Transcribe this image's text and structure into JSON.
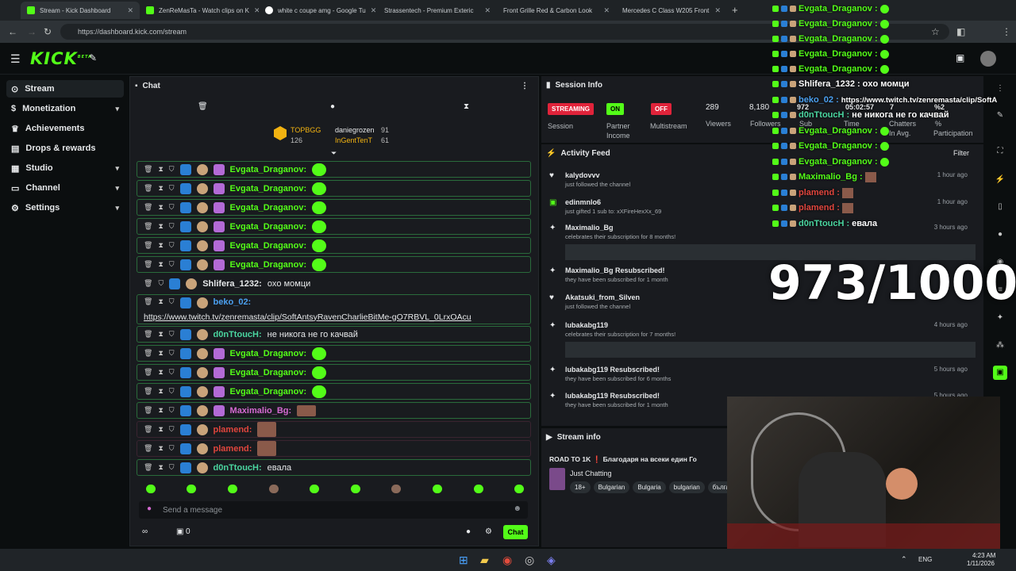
{
  "browser": {
    "tabs": [
      {
        "label": "Stream - Kick Dashboard",
        "active": true
      },
      {
        "label": "ZenReMasTa - Watch clips on K"
      },
      {
        "label": "white c coupe amg - Google Tu"
      },
      {
        "label": "Strassentech - Premium Exteric"
      },
      {
        "label": "Front Grille Red & Carbon Look"
      },
      {
        "label": "Mercedes C Class W205 Front"
      }
    ],
    "url": "https://dashboard.kick.com/stream"
  },
  "brand": {
    "logo": "KICK",
    "beta": "BETA"
  },
  "sidebar": {
    "items": [
      {
        "label": "Stream",
        "icon": "broadcast-icon"
      },
      {
        "label": "Monetization",
        "icon": "dollar-icon"
      },
      {
        "label": "Achievements",
        "icon": "trophy-icon"
      },
      {
        "label": "Drops & rewards",
        "icon": "gift-icon"
      },
      {
        "label": "Studio",
        "icon": "studio-icon"
      },
      {
        "label": "Channel",
        "icon": "channel-icon"
      },
      {
        "label": "Settings",
        "icon": "gear-icon"
      }
    ]
  },
  "chat": {
    "title": "Chat",
    "top_gifters": {
      "label": "TOPBGG",
      "count": "126"
    },
    "pinned_users": [
      {
        "name": "daniegrozen",
        "count": "91"
      },
      {
        "name": "InGentTenT",
        "count": "61"
      }
    ],
    "messages": [
      {
        "user": "Evgata_Draganov:",
        "text": "",
        "color": "green"
      },
      {
        "user": "Evgata_Draganov:",
        "text": "",
        "color": "green"
      },
      {
        "user": "Evgata_Draganov:",
        "text": "",
        "color": "green"
      },
      {
        "user": "Evgata_Draganov:",
        "text": "",
        "color": "green"
      },
      {
        "user": "Evgata_Draganov:",
        "text": "",
        "color": "green"
      },
      {
        "user": "Evgata_Draganov:",
        "text": "",
        "color": "green"
      },
      {
        "user": "Shlifera_1232:",
        "text": "oxo момци",
        "color": "plain"
      },
      {
        "user": "beko_02:",
        "text": "https://www.twitch.tv/zenremasta/clip/SoftAntsyRavenCharlieBitMe-gO7RBVL_0LrxOAcu",
        "color": "blue"
      },
      {
        "user": "d0nTtoucH:",
        "text": "не никога не го качвай",
        "color": "teal"
      },
      {
        "user": "Evgata_Draganov:",
        "text": "",
        "color": "green"
      },
      {
        "user": "Evgata_Draganov:",
        "text": "",
        "color": "green"
      },
      {
        "user": "Evgata_Draganov:",
        "text": "",
        "color": "green"
      },
      {
        "user": "Maximalio_Bg:",
        "text": "",
        "color": "pink"
      },
      {
        "user": "plamend:",
        "text": "",
        "color": "red"
      },
      {
        "user": "plamend:",
        "text": "",
        "color": "red"
      },
      {
        "user": "d0nTtoucH:",
        "text": "евала",
        "color": "teal"
      }
    ],
    "input_placeholder": "Send a message",
    "chat_button": "Chat",
    "viewer_count": "0"
  },
  "session": {
    "title": "Session Info",
    "streaming": "STREAMING",
    "streaming_label": "Session",
    "on": "ON",
    "on_label_1": "Partner",
    "on_label_2": "Income",
    "off": "OFF",
    "off_label": "Multistream",
    "viewers": "289",
    "viewers_label": "Viewers",
    "followers": "8,180",
    "followers_label": "Followers"
  },
  "feed": {
    "title": "Activity Feed",
    "filter": "Filter",
    "items": [
      {
        "name": "kalydovvv",
        "sub": "just followed the channel",
        "time": "1 hour ago"
      },
      {
        "name": "edinmnlo6",
        "sub": "just gifted 1 sub to: xXFireHexXx_69",
        "time": "1 hour ago"
      },
      {
        "name": "Maximalio_Bg",
        "sub": "celebrates their subscription for 8 months!",
        "time": "3 hours ago"
      },
      {
        "name": "Maximalio_Bg Resubscribed!",
        "sub": "they have been subscribed for 1 month",
        "time": ""
      },
      {
        "name": "Akatsuki_from_Silven",
        "sub": "just followed the channel",
        "time": ""
      },
      {
        "name": "lubakabg119",
        "sub": "celebrates their subscription for 7 months!",
        "time": "4 hours ago"
      },
      {
        "name": "lubakabg119 Resubscribed!",
        "sub": "they have been subscribed for 6 months",
        "time": "5 hours ago"
      },
      {
        "name": "lubakabg119 Resubscribed!",
        "sub": "they have been subscribed for 1 month",
        "time": "5 hours ago"
      }
    ]
  },
  "stream_info": {
    "title": "Stream info",
    "stream_title": "ROAD TO 1K ❗ Благодаря на всеки един Го",
    "category": "Just Chatting",
    "tags": [
      "18+",
      "Bulgarian",
      "Bulgaria",
      "bulgarian",
      "българ"
    ]
  },
  "overlay": {
    "lines": [
      {
        "user": "Evgata_Draganov :",
        "text": "",
        "color": "green"
      },
      {
        "user": "Evgata_Draganov :",
        "text": "",
        "color": "green"
      },
      {
        "user": "Evgata_Draganov :",
        "text": "",
        "color": "green"
      },
      {
        "user": "Evgata_Draganov :",
        "text": "",
        "color": "green"
      },
      {
        "user": "Evgata_Draganov :",
        "text": "",
        "color": "green"
      },
      {
        "user": "Shlifera_1232 :",
        "text": "oxo момци",
        "color": "white"
      },
      {
        "user": "beko_02 :",
        "text": "https://www.twitch.tv/zenremasta/clip/SoftA",
        "color": "blue"
      },
      {
        "user": "d0nTtoucH :",
        "text": "не никога не го качвай",
        "color": "teal"
      },
      {
        "user": "Evgata_Draganov :",
        "text": "",
        "color": "green"
      },
      {
        "user": "Evgata_Draganov :",
        "text": "",
        "color": "green"
      },
      {
        "user": "Evgata_Draganov :",
        "text": "",
        "color": "green"
      },
      {
        "user": "Maximalio_Bg :",
        "text": "",
        "color": "green"
      },
      {
        "user": "plamend :",
        "text": "",
        "color": "red"
      },
      {
        "user": "plamend :",
        "text": "",
        "color": "red"
      },
      {
        "user": "d0nTtoucH :",
        "text": "евала",
        "color": "teal"
      }
    ],
    "stats_line": {
      "a": "972",
      "b": "05:02:57",
      "c": "7",
      "d": "%2"
    },
    "stats_labels": {
      "sub": "Sub",
      "time": "Time",
      "chatters": "Chatters",
      "inavg": "In Avg.",
      "pct": "%",
      "participation": "Participation"
    },
    "goal": "973/1000"
  },
  "taskbar": {
    "lang": "ENG",
    "time": "4:23 AM",
    "date": "1/11/2026"
  },
  "colors": {
    "accent": "#53fc18",
    "streaming": "#e0233a",
    "on": "#53fc18",
    "off": "#e0233a"
  }
}
